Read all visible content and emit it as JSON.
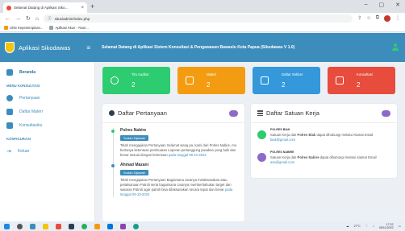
{
  "browser": {
    "tab_title": "Selamat Datang di Aplikasi Siko...",
    "tab_close": "×",
    "new_tab": "+",
    "url": "situs/admin/index.php",
    "bookmarks": [
      "UNS Kepemimpinan...",
      "Aplikasi Akun - Akun..."
    ]
  },
  "app": {
    "brand": "Aplikasi Sikodawas",
    "header_title": "Selamat Datang di Aplikasi Sistem Konsultasi & Pengawasan Bawaslu Kota Papua (Sikodawas V 1.0)"
  },
  "sidebar": {
    "items": [
      {
        "label": "Beranda",
        "icon": "home-icon"
      },
      {
        "label": "Pertanyaan",
        "icon": "question-icon"
      },
      {
        "label": "Daftar Materi",
        "icon": "book-icon"
      },
      {
        "label": "Konsultasiku",
        "icon": "chat-icon"
      },
      {
        "label": "Keluar",
        "icon": "logout-icon"
      }
    ],
    "headers": [
      "MENU KONSULTASI",
      "KONFIGURASI"
    ]
  },
  "info_boxes": [
    {
      "label": "Tim Auditor",
      "value": "2",
      "color": "#2ecc71"
    },
    {
      "label": "Materi",
      "value": "2",
      "color": "#f39c12"
    },
    {
      "label": "Daftar Sekber",
      "value": "2",
      "color": "#3498db"
    },
    {
      "label": "Konsultasi",
      "value": "2",
      "color": "#e74c3c"
    }
  ],
  "questions_panel": {
    "title": "Daftar Pertanyaan",
    "items": [
      {
        "name": "Polres Nabire",
        "chip": "Sudah Dijawab",
        "text": "Telah mengajukan Pertanyaan Selamat siang pa. kami dari Polres Nabire, mo bertanya ketentuan pembuatan Laporan pertanggung jawaban yang baik dan benar sesuai dengan ketentuan",
        "when": "pada tanggal 09-10-2022"
      },
      {
        "name": "Ahmad Mazani",
        "chip": "Sudah Dijawab",
        "text": "Telah mengajukan Pertanyaan Bagaimana caranya melaksanakan atau pelaksanaan Patroli serta bagaimana caranya memberitahukan target dan sasaran Patroli agar patroli bisa dilaksanakan secara tepat dan benar",
        "when": "pada tanggal 09-10-2022"
      }
    ]
  },
  "units_panel": {
    "title": "Daftar Satuan Kerja",
    "items": [
      {
        "name": "POLRES BIAK",
        "text_pre": "Satuan Kerja dari",
        "unit": "Polres Biak",
        "text_post": "dapat dihubungi melalui Alamat Email",
        "email": "biak@gmail.com"
      },
      {
        "name": "POLRES NABIRE",
        "text_pre": "Satuan Kerja dari",
        "unit": "Polres Nabire",
        "text_post": "dapat dihubungi melalui Alamat Email",
        "email": "asa@gmail.com"
      }
    ]
  },
  "taskbar": {
    "weather": "27°C",
    "time": "17:22",
    "date": "05/11/2022"
  }
}
